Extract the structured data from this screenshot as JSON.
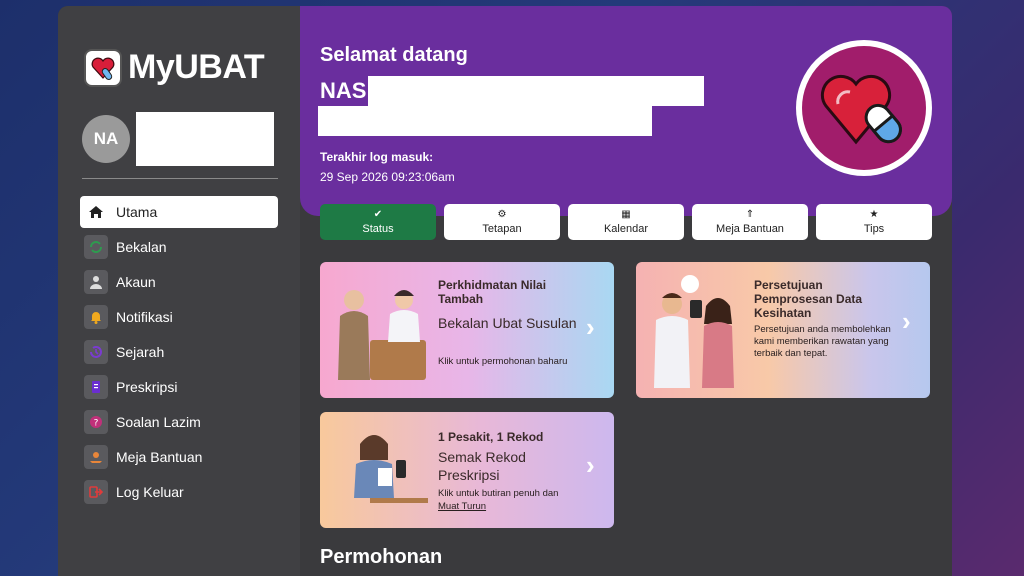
{
  "app": {
    "logo_text": "MyUBAT"
  },
  "user": {
    "initials": "NA"
  },
  "menu": [
    {
      "label": "Utama",
      "icon": "home-icon",
      "color": "#222222"
    },
    {
      "label": "Bekalan",
      "icon": "supply-icon",
      "color": "#2e9b4f"
    },
    {
      "label": "Akaun",
      "icon": "person-icon",
      "color": "#dddddd"
    },
    {
      "label": "Notifikasi",
      "icon": "bell-icon",
      "color": "#f0a91e"
    },
    {
      "label": "Sejarah",
      "icon": "history-icon",
      "color": "#7a3bd0"
    },
    {
      "label": "Preskripsi",
      "icon": "prescription-icon",
      "color": "#6a2ed0"
    },
    {
      "label": "Soalan Lazim",
      "icon": "faq-icon",
      "color": "#c0307a"
    },
    {
      "label": "Meja Bantuan",
      "icon": "helpdesk-icon",
      "color": "#e8863a"
    },
    {
      "label": "Log Keluar",
      "icon": "logout-icon",
      "color": "#e03b3b"
    }
  ],
  "hero": {
    "welcome": "Selamat datang",
    "name": "NAS",
    "last_login_label": "Terakhir log masuk:",
    "last_login_value": "29 Sep 2026 09:23:06am"
  },
  "tabs": [
    {
      "label": "Status",
      "icon": "check-circle-icon",
      "glyph": "✔"
    },
    {
      "label": "Tetapan",
      "icon": "gear-icon",
      "glyph": "⚙"
    },
    {
      "label": "Kalendar",
      "icon": "calendar-icon",
      "glyph": "▦"
    },
    {
      "label": "Meja Bantuan",
      "icon": "helpdesk-icon",
      "glyph": "⇑"
    },
    {
      "label": "Tips",
      "icon": "star-icon",
      "glyph": "★"
    }
  ],
  "cards": [
    {
      "title": "Perkhidmatan Nilai Tambah",
      "subtitle": "Bekalan Ubat Susulan",
      "desc": "Klik untuk permohonan baharu"
    },
    {
      "title": "Persetujuan Pemprosesan Data Kesihatan",
      "desc": "Persetujuan anda membolehkan kami memberikan rawatan yang terbaik dan tepat."
    },
    {
      "title": "1 Pesakit, 1 Rekod",
      "subtitle": "Semak Rekod Preskripsi",
      "desc": "Klik untuk butiran penuh dan",
      "link": "Muat Turun"
    }
  ],
  "section": {
    "title": "Permohonan"
  },
  "colors": {
    "hero_purple": "#6a2e9e",
    "status_green": "#1e7a45",
    "sidebar_bg": "#404043",
    "badge_magenta": "#a11d6b"
  }
}
